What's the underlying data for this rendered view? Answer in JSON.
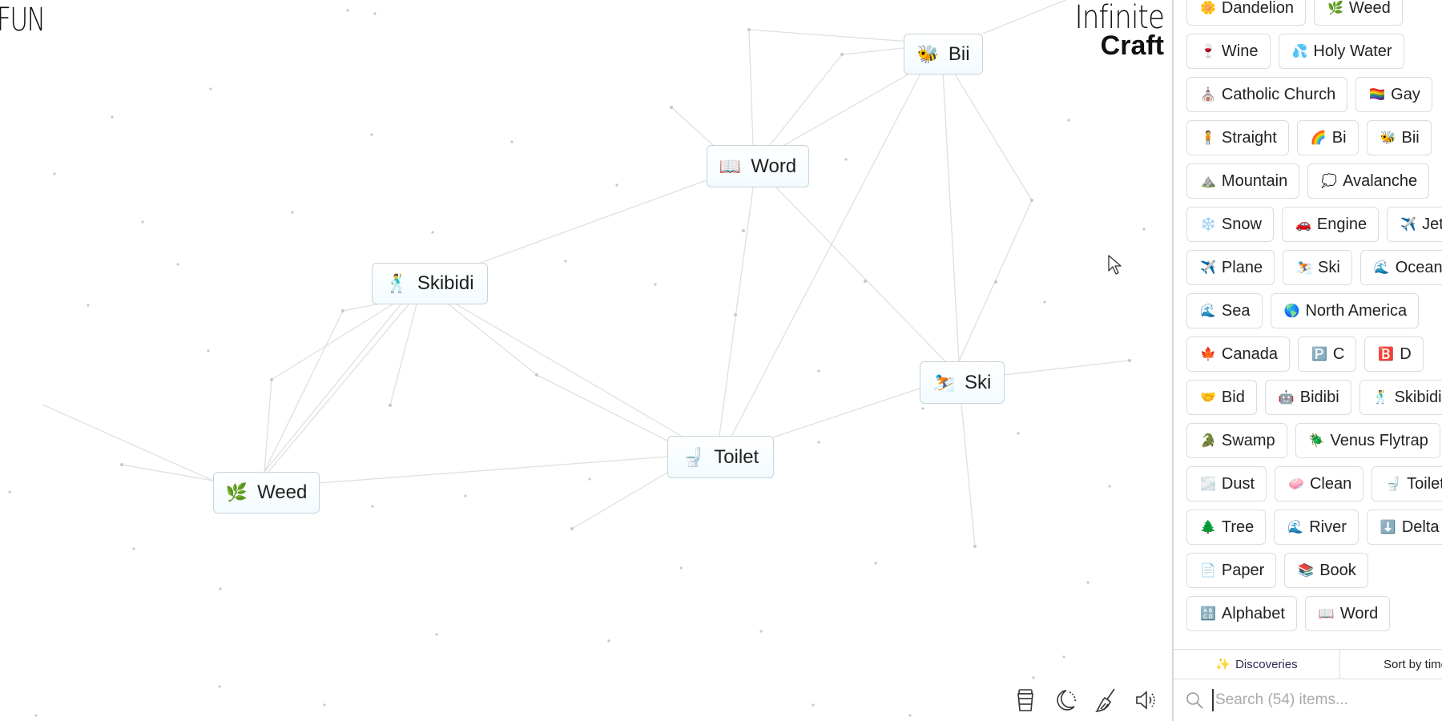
{
  "canvas": {
    "corner_text": "FUN",
    "logo": {
      "line1": "Infinite",
      "line2": "Craft"
    },
    "nodes": [
      {
        "id": "bii",
        "label": "Bii",
        "icon": "bee-icon",
        "emoji": "🐝"
      },
      {
        "id": "word",
        "label": "Word",
        "icon": "open-book-icon",
        "emoji": "📖"
      },
      {
        "id": "skibidi",
        "label": "Skibidi",
        "icon": "dancing-man-icon",
        "emoji": "🕺"
      },
      {
        "id": "ski",
        "label": "Ski",
        "icon": "skier-icon",
        "emoji": "⛷️"
      },
      {
        "id": "toilet",
        "label": "Toilet",
        "icon": "toilet-icon",
        "emoji": "🚽"
      },
      {
        "id": "weed",
        "label": "Weed",
        "icon": "herb-icon",
        "emoji": "🌿"
      }
    ],
    "toolbar": [
      {
        "name": "coffee-cup-icon",
        "label": "Support"
      },
      {
        "name": "moon-icon",
        "label": "Dark mode"
      },
      {
        "name": "broom-icon",
        "label": "Clear"
      },
      {
        "name": "speaker-icon",
        "label": "Sound"
      }
    ]
  },
  "sidebar": {
    "items": [
      {
        "label": "Dandelion",
        "emoji": "🌼",
        "icon": "dandelion-icon"
      },
      {
        "label": "Weed",
        "emoji": "🌿",
        "icon": "herb-icon"
      },
      {
        "label": "Wine",
        "emoji": "🍷",
        "icon": "wine-glass-icon"
      },
      {
        "label": "Holy Water",
        "emoji": "💦",
        "icon": "water-drops-icon"
      },
      {
        "label": "Catholic Church",
        "emoji": "⛪",
        "icon": "church-icon"
      },
      {
        "label": "Gay",
        "emoji": "🏳️‍🌈",
        "icon": "rainbow-flag-icon"
      },
      {
        "label": "Straight",
        "emoji": "🧍",
        "icon": "person-standing-icon"
      },
      {
        "label": "Bi",
        "emoji": "🌈",
        "icon": "rainbow-icon"
      },
      {
        "label": "Bii",
        "emoji": "🐝",
        "icon": "bee-icon"
      },
      {
        "label": "Mountain",
        "emoji": "⛰️",
        "icon": "mountain-icon"
      },
      {
        "label": "Avalanche",
        "emoji": "💭",
        "icon": "thought-bubble-icon"
      },
      {
        "label": "Snow",
        "emoji": "❄️",
        "icon": "snowflake-icon"
      },
      {
        "label": "Engine",
        "emoji": "🚗",
        "icon": "car-icon"
      },
      {
        "label": "Jet",
        "emoji": "✈️",
        "icon": "airplane-icon"
      },
      {
        "label": "Plane",
        "emoji": "✈️",
        "icon": "airplane-icon"
      },
      {
        "label": "Ski",
        "emoji": "⛷️",
        "icon": "skier-icon"
      },
      {
        "label": "Ocean",
        "emoji": "🌊",
        "icon": "wave-icon"
      },
      {
        "label": "Sea",
        "emoji": "🌊",
        "icon": "wave-icon"
      },
      {
        "label": "North America",
        "emoji": "🌎",
        "icon": "globe-americas-icon"
      },
      {
        "label": "Canada",
        "emoji": "🍁",
        "icon": "maple-leaf-icon"
      },
      {
        "label": "C",
        "emoji": "🅿️",
        "icon": "p-button-icon"
      },
      {
        "label": "D",
        "emoji": "🅱️",
        "icon": "b-button-icon"
      },
      {
        "label": "Bid",
        "emoji": "🤝",
        "icon": "handshake-icon"
      },
      {
        "label": "Bidibi",
        "emoji": "🤖",
        "icon": "robot-icon"
      },
      {
        "label": "Skibidi",
        "emoji": "🕺",
        "icon": "dancing-man-icon"
      },
      {
        "label": "Swamp",
        "emoji": "🐊",
        "icon": "crocodile-icon"
      },
      {
        "label": "Venus Flytrap",
        "emoji": "🪲",
        "icon": "beetle-icon"
      },
      {
        "label": "Dust",
        "emoji": "🌫️",
        "icon": "fog-icon"
      },
      {
        "label": "Clean",
        "emoji": "🧼",
        "icon": "soap-icon"
      },
      {
        "label": "Toilet",
        "emoji": "🚽",
        "icon": "toilet-icon"
      },
      {
        "label": "Tree",
        "emoji": "🌲",
        "icon": "tree-icon"
      },
      {
        "label": "River",
        "emoji": "🌊",
        "icon": "wave-icon"
      },
      {
        "label": "Delta",
        "emoji": "⬇️",
        "icon": "down-arrow-icon"
      },
      {
        "label": "Paper",
        "emoji": "📄",
        "icon": "page-icon"
      },
      {
        "label": "Book",
        "emoji": "📚",
        "icon": "books-icon"
      },
      {
        "label": "Alphabet",
        "emoji": "🔠",
        "icon": "abcd-icon"
      },
      {
        "label": "Word",
        "emoji": "📖",
        "icon": "open-book-icon"
      }
    ],
    "tabs": [
      {
        "label": "Discoveries",
        "icon": "sparkles-icon"
      },
      {
        "label": "Sort by time",
        "icon": "timer-icon"
      }
    ],
    "search": {
      "placeholder": "Search (54) items...",
      "value": ""
    }
  }
}
